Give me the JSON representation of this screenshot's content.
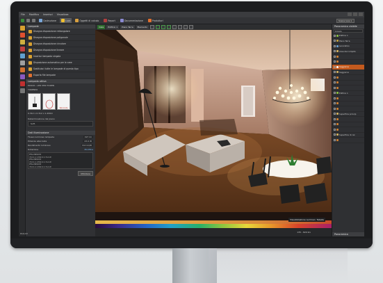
{
  "titlebar": {
    "menu": [
      "File",
      "Modifica",
      "Inserisci",
      "Visualizza"
    ]
  },
  "toolbar": {
    "items": [
      {
        "label": "Costruzione",
        "icon": "wall-icon",
        "color": "#7aa6d8"
      },
      {
        "label": "Luce",
        "icon": "bulb-icon",
        "color": "#f0c030",
        "active": true
      },
      {
        "label": "Oggetti di calcolo",
        "icon": "grid-icon",
        "color": "#d8a040"
      },
      {
        "label": "Report",
        "icon": "report-icon",
        "color": "#b04040"
      },
      {
        "label": "Documentazione",
        "icon": "doc-icon",
        "color": "#8a8ad0"
      },
      {
        "label": "Produttori",
        "icon": "factory-icon",
        "color": "#e07030"
      }
    ],
    "scene_select": "Scena luce 1"
  },
  "toolbar2": {
    "view_label": "Vista",
    "building_label": "Edificio 1",
    "floor_label": "Piano Terra",
    "element_label": "Elemento"
  },
  "left_panel": {
    "section_title": "Lampade",
    "items": [
      {
        "label": "Disegna disposizione rettangolare",
        "color": "#d8a030"
      },
      {
        "label": "Disegna disposizione poligonale",
        "color": "#d8a030"
      },
      {
        "label": "Disegna disposizione circolare",
        "color": "#d8a030"
      },
      {
        "label": "Disegna disposizione lineare",
        "color": "#d8a030"
      },
      {
        "label": "Inserisci lampada singola",
        "color": "#d8a030"
      },
      {
        "label": "Disposizione automatica per le aree",
        "color": "#d8a030"
      },
      {
        "label": "Sostituisci tutte le lampade di questo tipo",
        "color": "#d8a030"
      },
      {
        "label": "Esporta file lampade",
        "color": "#e07030"
      }
    ],
    "active_lamp_title": "Lampada attiva",
    "lamp_code": "MX100 - LED M30 TOKEN",
    "lamp_name": "TOKEN50",
    "thumb_brand": "Teknoinde",
    "lamp_dims": "0.312 x 0.312 x 1.200m",
    "mounting_label": "Determinazione del piano",
    "mounting_value": "Soff.",
    "section2_title": "Dati illuminazione",
    "fields": [
      {
        "label": "Flusso luminoso lampade",
        "value": "197 lm"
      },
      {
        "label": "Potenza allacciata",
        "value": "23.0 W"
      },
      {
        "label": "Rendimento luminoso",
        "value": "8.6 lm/W"
      }
    ],
    "modify_label": "Modifica",
    "dotazione_label": "Dotazione",
    "dotazione_lines": [
      "PTG-M95033",
      "79 lm  1  1700 K  1  5.0 W",
      "PTG-M95033",
      "79 lm  1  2700 K  1  5.0 W",
      "PTG-M95033",
      "79 lm  1  1700 K  1  5.0 W"
    ],
    "apply_label": "Utilizzare"
  },
  "right_panel": {
    "title": "Panoramica visibile",
    "filter": "Circolo",
    "tree": [
      {
        "label": "Edificio 1",
        "color": "#8ac040"
      },
      {
        "label": "Piano Terra",
        "color": "#c0a040"
      },
      {
        "label": "Lavorativo",
        "color": "#6aa0d0"
      },
      {
        "label": "Area del compito",
        "color": "#d0b060"
      },
      {
        "label": "",
        "color": "#d08030"
      },
      {
        "label": "",
        "color": "#d08030"
      },
      {
        "label": "Soggiorno",
        "color": "#ffffff",
        "selected": true
      },
      {
        "label": "Soggiorno",
        "color": "#d0b060"
      },
      {
        "label": "",
        "color": "#d08030"
      },
      {
        "label": "",
        "color": "#d08030"
      },
      {
        "label": "",
        "color": "#d08030"
      },
      {
        "label": "Edificio 1",
        "color": "#8ac040"
      },
      {
        "label": "",
        "color": "#d08030"
      },
      {
        "label": "",
        "color": "#d08030"
      },
      {
        "label": "",
        "color": "#d08030"
      },
      {
        "label": "Superficie princip",
        "color": "#d0b060"
      },
      {
        "label": "",
        "color": "#d08030"
      },
      {
        "label": "",
        "color": "#d08030"
      },
      {
        "label": "",
        "color": "#d08030"
      },
      {
        "label": "Superficie di cal",
        "color": "#d0b060"
      },
      {
        "label": "",
        "color": "#d08030"
      }
    ],
    "footer": "Panoramica"
  },
  "statusbar": {
    "luminance_label": "Visualizzazione Luminan",
    "table_label": "Tabelle",
    "scale_text": "135 - 829 klx"
  },
  "brand": "DIALUX"
}
